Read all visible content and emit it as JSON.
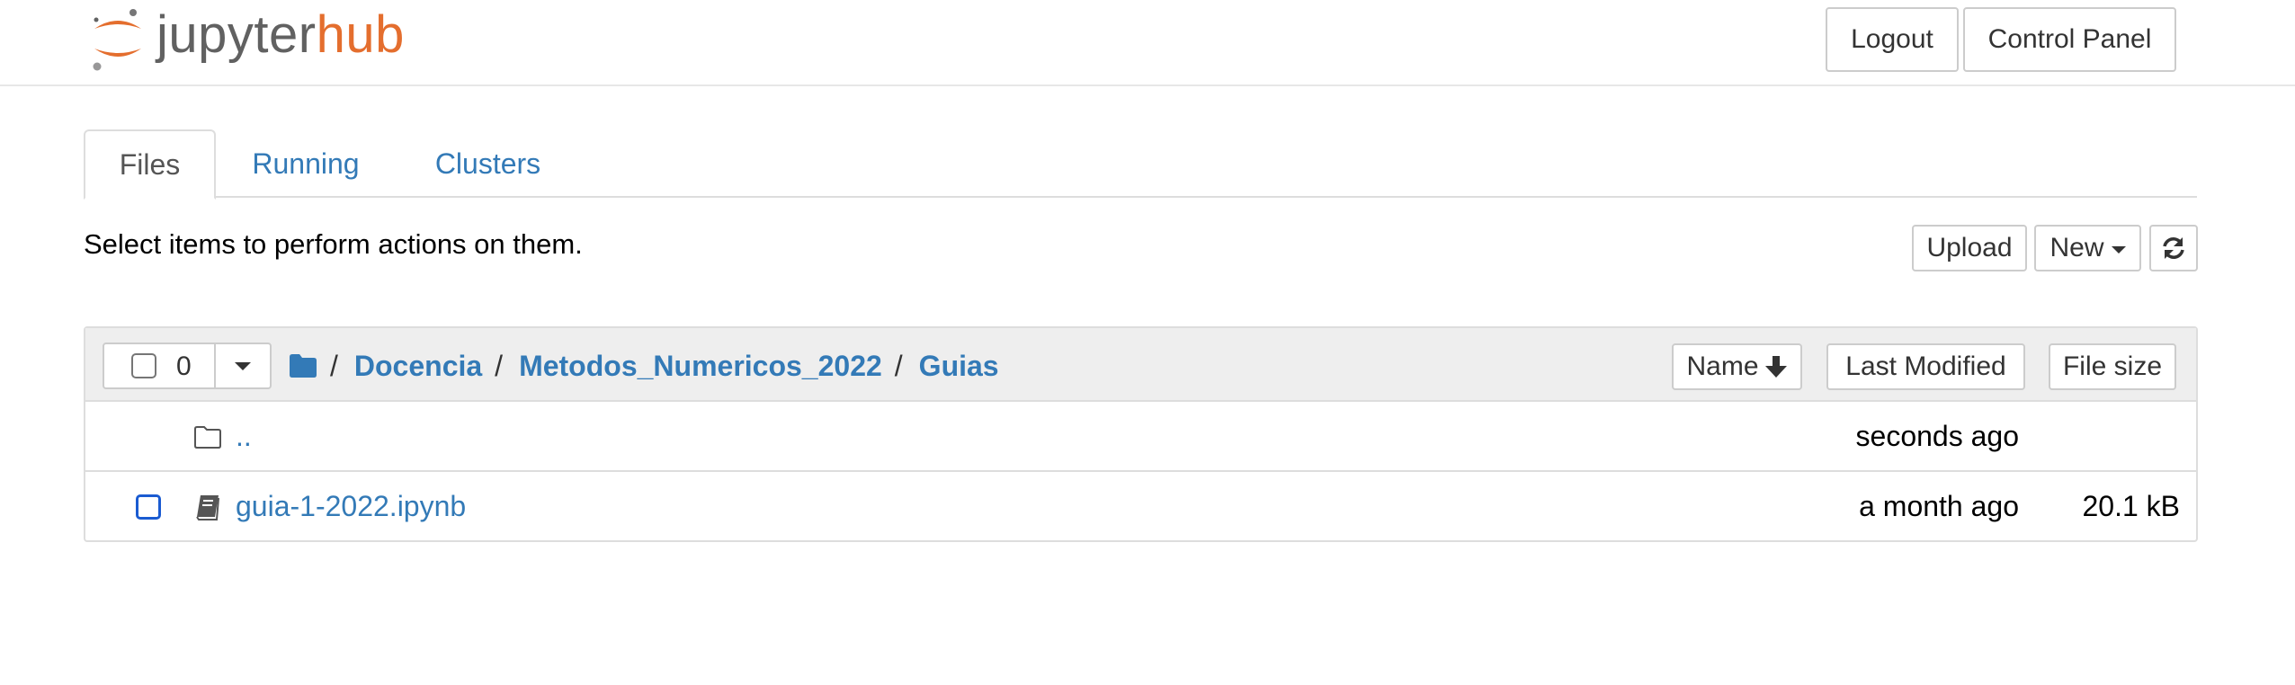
{
  "header": {
    "logo": {
      "part1": "jupyter",
      "part2": "hub"
    },
    "logout_label": "Logout",
    "control_panel_label": "Control Panel"
  },
  "tabs": [
    {
      "label": "Files",
      "active": true
    },
    {
      "label": "Running",
      "active": false
    },
    {
      "label": "Clusters",
      "active": false
    }
  ],
  "toolbar": {
    "instructions": "Select items to perform actions on them.",
    "upload_label": "Upload",
    "new_label": "New",
    "refresh_icon": "refresh-icon"
  },
  "file_list": {
    "selected_count": "0",
    "breadcrumb": [
      {
        "label": "Docencia"
      },
      {
        "label": "Metodos_Numericos_2022"
      },
      {
        "label": "Guias"
      }
    ],
    "breadcrumb_separator": "/",
    "columns": {
      "name": "Name",
      "last_modified": "Last Modified",
      "file_size": "File size"
    },
    "rows": [
      {
        "icon": "folder-icon",
        "name": "..",
        "modified": "seconds ago",
        "size": ""
      },
      {
        "icon": "notebook-icon",
        "name": "guia-1-2022.ipynb",
        "modified": "a month ago",
        "size": "20.1 kB"
      }
    ]
  },
  "colors": {
    "link": "#337ab7",
    "brand_orange": "#e46e2e",
    "brand_gray": "#616161",
    "header_bg": "#eeeeee",
    "checkbox_focus": "#1a5bd1"
  }
}
